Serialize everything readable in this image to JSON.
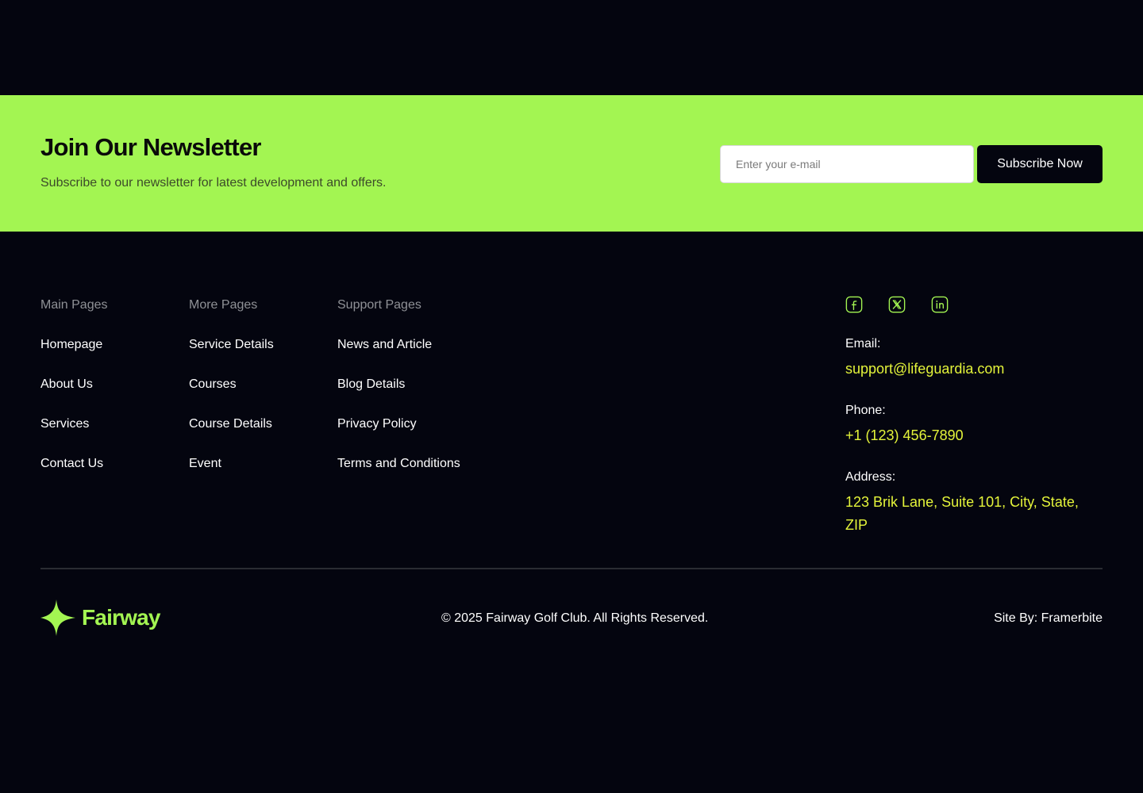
{
  "newsletter": {
    "title": "Join Our Newsletter",
    "subtitle": "Subscribe to our newsletter for latest development and offers.",
    "email_placeholder": "Enter your e-mail",
    "email_value": "",
    "button_label": "Subscribe Now"
  },
  "columns": [
    {
      "heading": "Main Pages",
      "links": [
        "Homepage",
        "About Us",
        "Services",
        "Contact Us"
      ]
    },
    {
      "heading": "More Pages",
      "links": [
        "Service Details",
        "Courses",
        "Course Details",
        "Event"
      ]
    },
    {
      "heading": "Support Pages",
      "links": [
        "News and Article",
        "Blog Details",
        "Privacy Policy",
        "Terms and Conditions"
      ]
    }
  ],
  "social": [
    {
      "icon": "facebook-icon"
    },
    {
      "icon": "x-twitter-icon"
    },
    {
      "icon": "linkedin-icon"
    }
  ],
  "contact": {
    "email_label": "Email:",
    "email_value": "support@lifeguardia.com",
    "phone_label": "Phone:",
    "phone_value": "+1 (123) 456-7890",
    "address_label": "Address:",
    "address_value": "123 Brik Lane, Suite 101, City, State, ZIP"
  },
  "footer": {
    "logo_text": "Fairway",
    "copyright": "© 2025 Fairway Golf Club. All Rights Reserved.",
    "site_by": "Site By: Framerbite"
  },
  "colors": {
    "background": "#04050f",
    "accent_green": "#a3f552",
    "accent_yellow": "#e4f43a",
    "muted_text": "#8f9196"
  }
}
